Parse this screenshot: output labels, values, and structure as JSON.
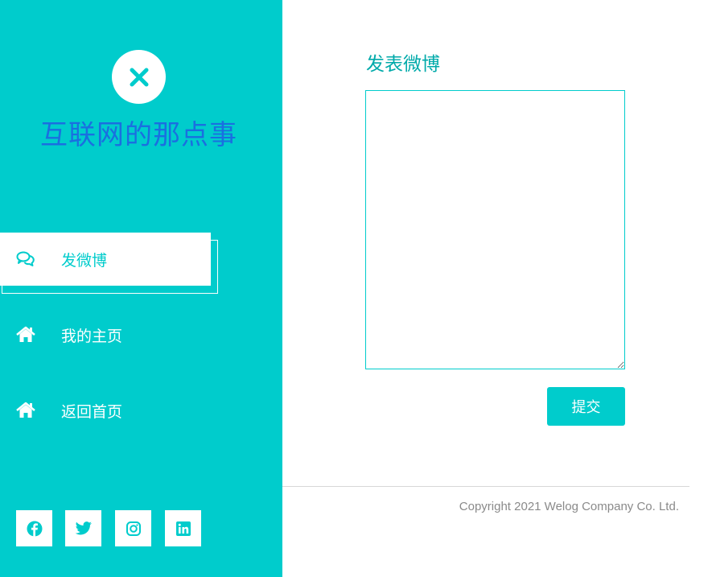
{
  "sidebar": {
    "logo_icon": "close-x-icon",
    "site_title": "互联网的那点事",
    "nav": [
      {
        "label": "发微博",
        "icon": "comments-icon",
        "active": true
      },
      {
        "label": "我的主页",
        "icon": "home-icon",
        "active": false
      },
      {
        "label": "返回首页",
        "icon": "home-icon",
        "active": false
      }
    ],
    "social": [
      "facebook-icon",
      "twitter-icon",
      "instagram-icon",
      "linkedin-icon"
    ]
  },
  "main": {
    "title": "发表微博",
    "textarea_value": "",
    "submit_label": "提交"
  },
  "footer": {
    "copyright": "Copyright 2021 Welog Company Co. Ltd."
  },
  "colors": {
    "accent": "#00cccc",
    "title_blue": "#1a6fe0",
    "heading_teal": "#00aaaa",
    "muted": "#8a8a8a"
  }
}
